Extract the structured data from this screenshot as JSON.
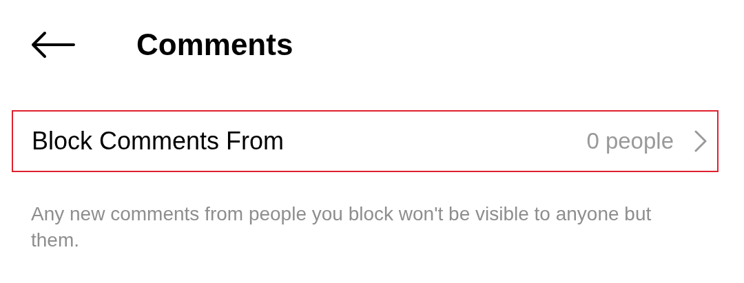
{
  "header": {
    "title": "Comments"
  },
  "setting": {
    "label": "Block Comments From",
    "value": "0 people",
    "highlighted": true
  },
  "description": "Any new comments from people you block won't be visible to anyone but them."
}
